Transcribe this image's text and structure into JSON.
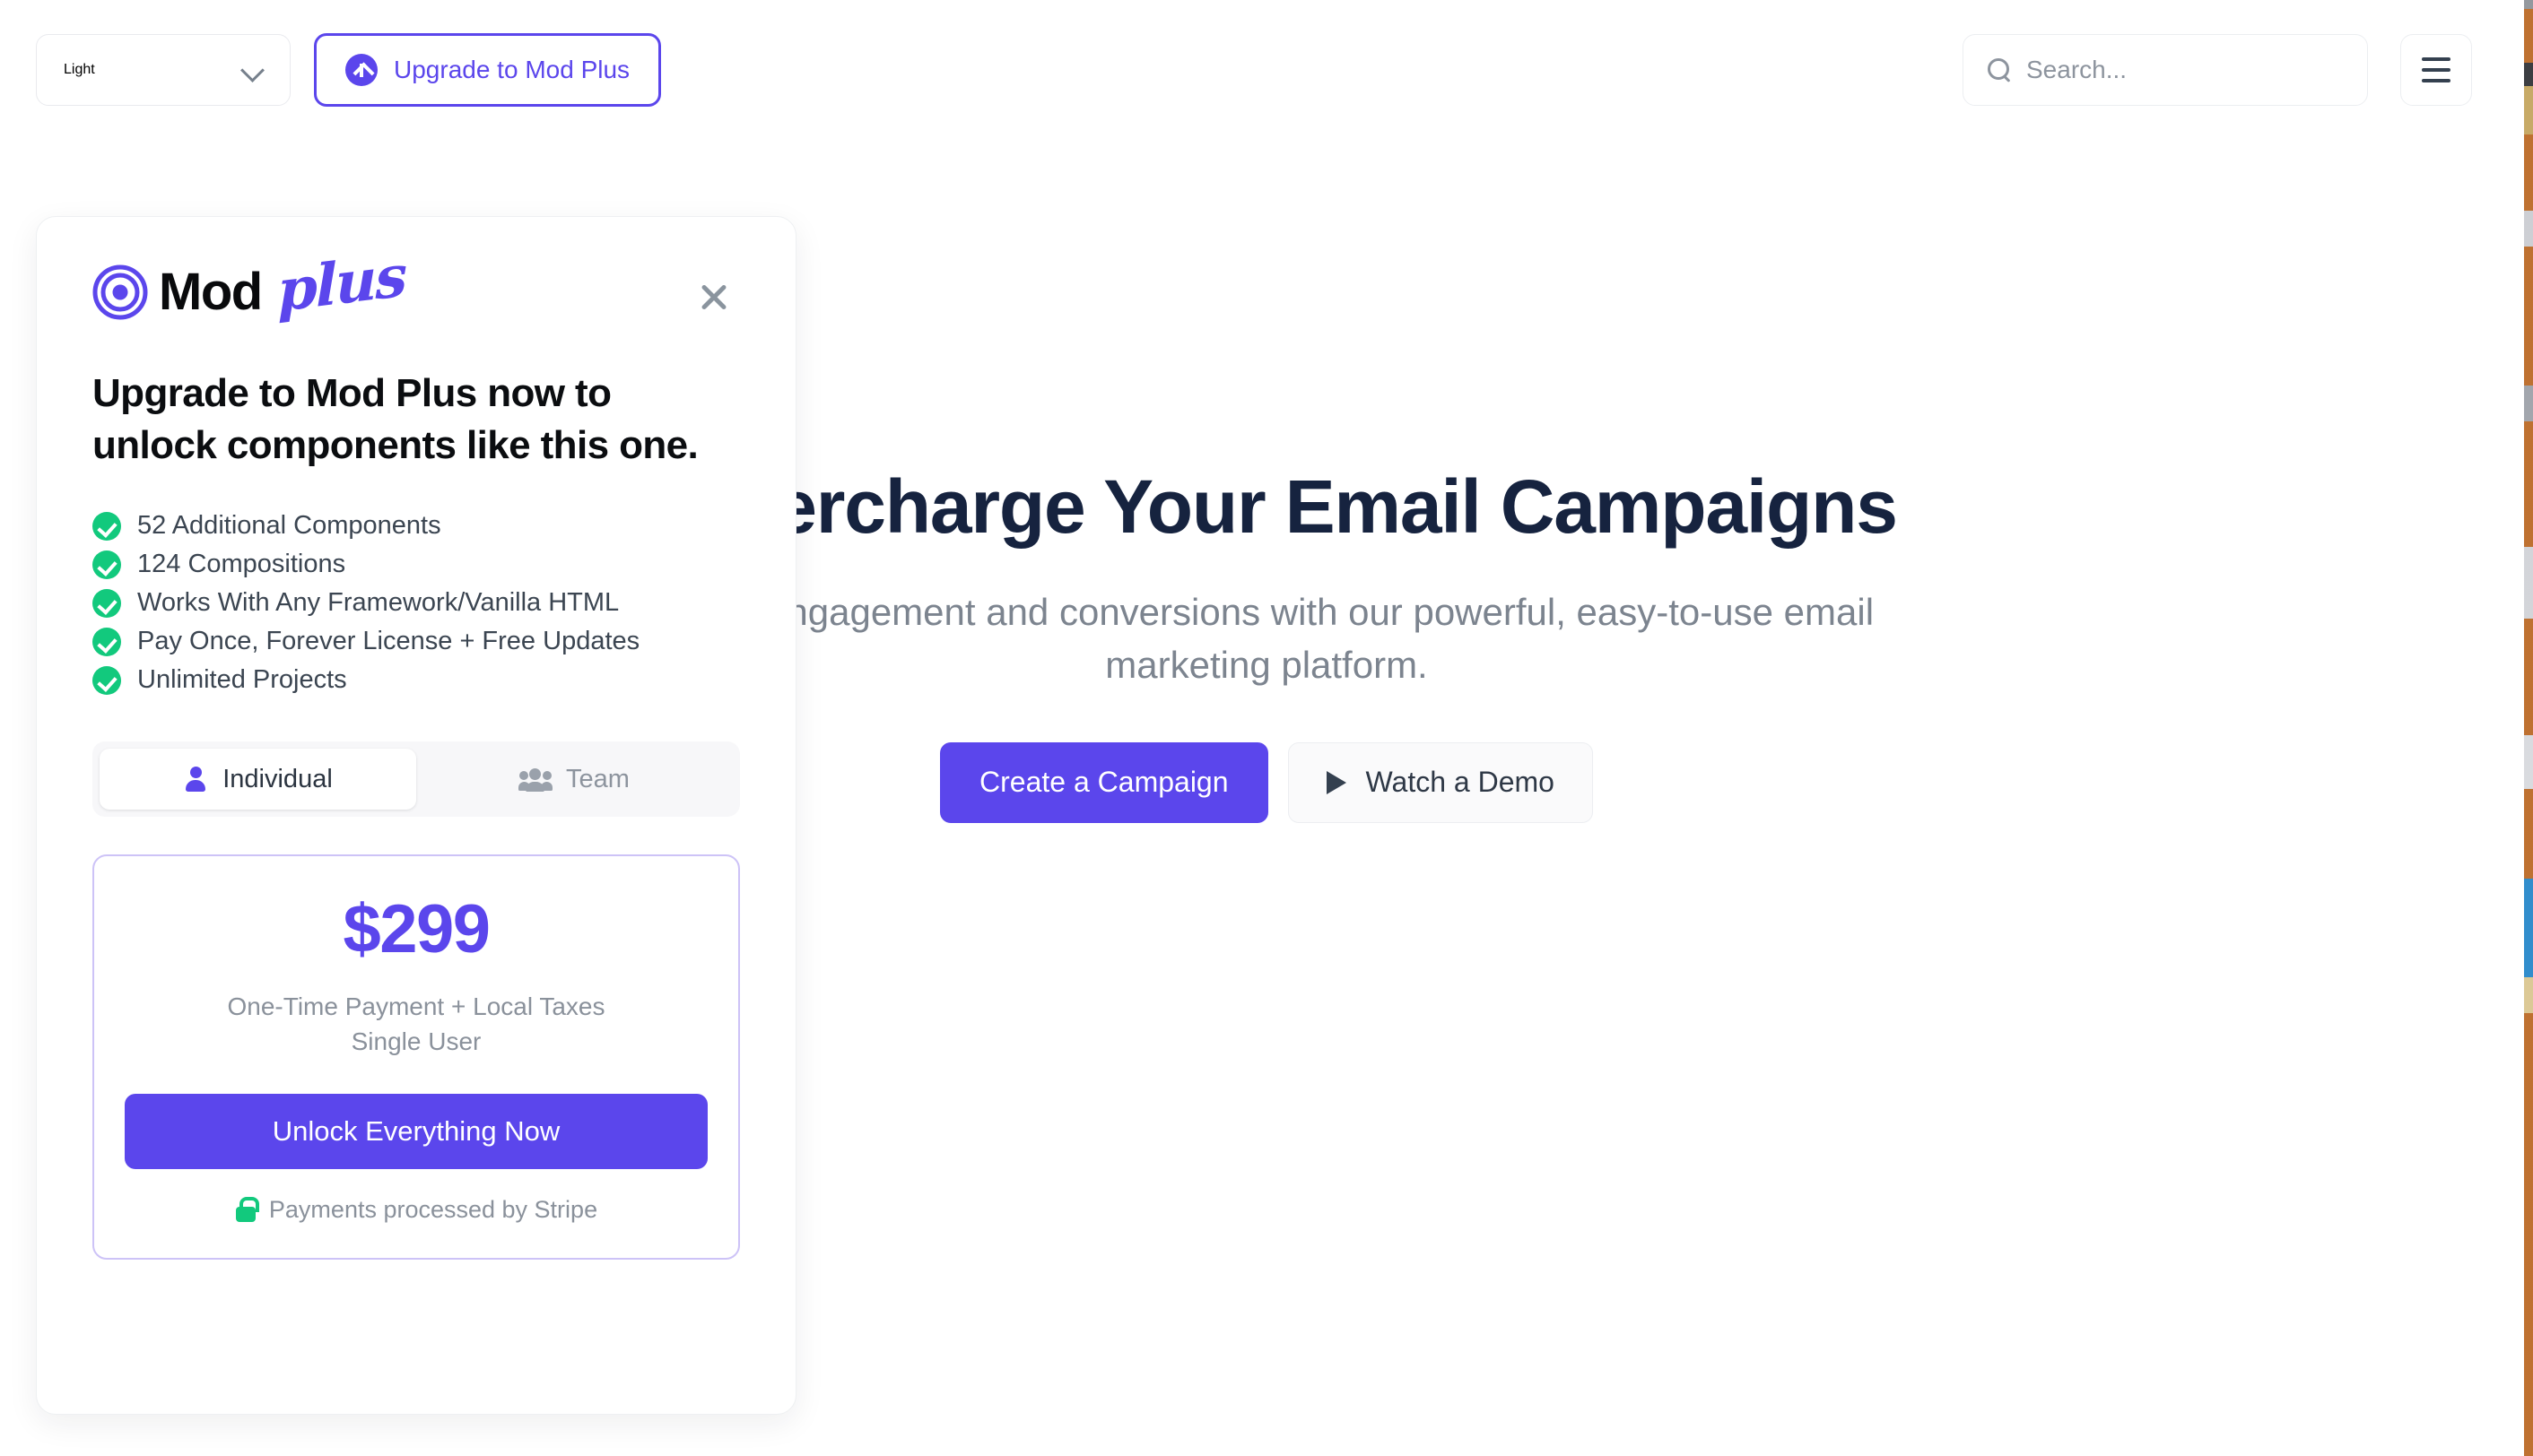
{
  "topbar": {
    "theme_label": "Light",
    "theme_icon": "chevron-down-icon",
    "upgrade_label": "Upgrade to Mod Plus",
    "upgrade_icon": "arrow-up-circle-icon",
    "search_placeholder": "Search...",
    "search_value": "",
    "search_icon": "search-icon",
    "menu_icon": "hamburger-menu-icon"
  },
  "hero": {
    "title": "Supercharge Your Email Campaigns",
    "subtitle": "Boost engagement and conversions with our powerful, easy-to-use email marketing platform.",
    "primary_cta": "Create a Campaign",
    "secondary_cta": "Watch a Demo",
    "secondary_icon": "play-icon"
  },
  "modal": {
    "brand": {
      "mark_icon": "concentric-target-icon",
      "name": "Mod",
      "suffix": "plus"
    },
    "close_icon": "close-icon",
    "title": "Upgrade to Mod Plus now to unlock components like this one.",
    "features": [
      {
        "icon": "check-circle-icon",
        "label": "52 Additional Components"
      },
      {
        "icon": "check-circle-icon",
        "label": "124 Compositions"
      },
      {
        "icon": "check-circle-icon",
        "label": "Works With Any Framework/Vanilla HTML"
      },
      {
        "icon": "check-circle-icon",
        "label": "Pay Once, Forever License + Free Updates"
      },
      {
        "icon": "check-circle-icon",
        "label": "Unlimited Projects"
      }
    ],
    "plan_tabs": [
      {
        "label": "Individual",
        "icon": "person-icon",
        "active": true
      },
      {
        "label": "Team",
        "icon": "people-group-icon",
        "active": false
      }
    ],
    "price": "$299",
    "price_note_line1": "One-Time Payment + Local Taxes",
    "price_note_line2": "Single User",
    "cta_label": "Unlock Everything Now",
    "secure_icon": "lock-icon",
    "secure_label": "Payments processed by Stripe"
  },
  "colors": {
    "brand_purple": "#5b46ec",
    "success_green": "#12c97d",
    "heading_navy": "#16233f",
    "muted_gray": "#8a919b",
    "card_border_purple": "#cdc3f7"
  }
}
